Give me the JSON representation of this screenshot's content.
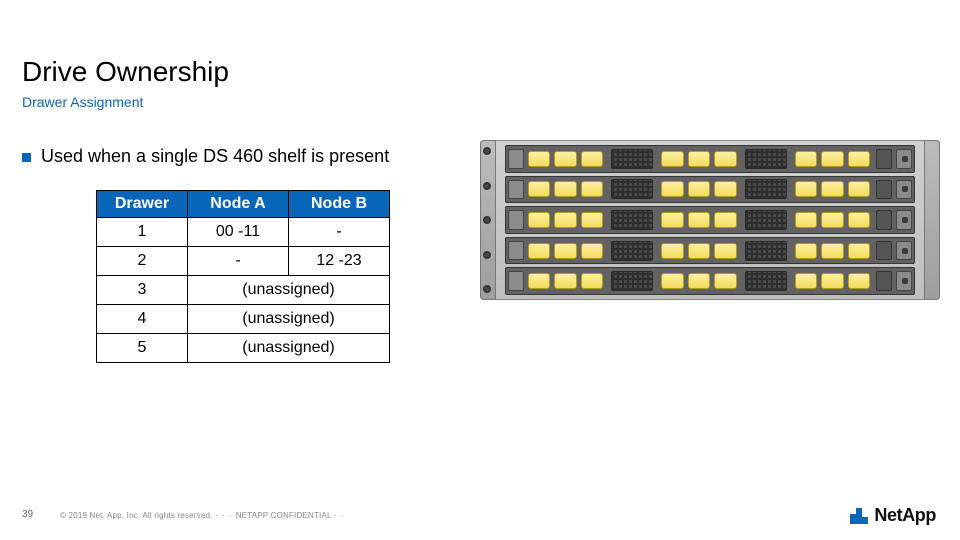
{
  "title": "Drive Ownership",
  "subtitle": "Drawer Assignment",
  "bullet": "Used when a single DS 460 shelf is present",
  "table": {
    "headers": [
      "Drawer",
      "Node A",
      "Node B"
    ],
    "rows": [
      {
        "drawer": "1",
        "a": "00 -11",
        "b": "-",
        "merged": false
      },
      {
        "drawer": "2",
        "a": "-",
        "b": "12 -23",
        "merged": false
      },
      {
        "drawer": "3",
        "merged_text": "(unassigned)",
        "merged": true
      },
      {
        "drawer": "4",
        "merged_text": "(unassigned)",
        "merged": true
      },
      {
        "drawer": "5",
        "merged_text": "(unassigned)",
        "merged": true
      }
    ]
  },
  "footer": {
    "page": "39",
    "copyright": "© 2019 Net. App, Inc. All rights reserved.",
    "confidential": "NETAPP CONFIDENTIAL",
    "logo_text": "NetApp"
  },
  "chassis": {
    "drawer_count": 5
  }
}
